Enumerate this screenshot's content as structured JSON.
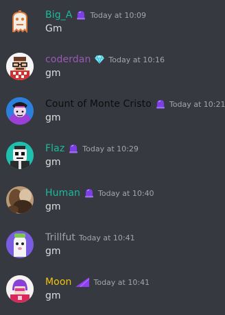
{
  "colors": {
    "background": "#36393f",
    "timestamp": "#a3a6aa",
    "message_text": "#dcddde"
  },
  "messages": [
    {
      "username": "Big_A",
      "color": "#1abc9c",
      "badge": "purple-orb-icon",
      "timestamp": "Today at 10:09",
      "content": "Gm",
      "avatar": "ghost-avatar-icon"
    },
    {
      "username": "coderdan",
      "color": "#9b59b6",
      "badge": "diamond-icon",
      "timestamp": "Today at 10:16",
      "content": "gm",
      "avatar": "glasses-avatar-icon"
    },
    {
      "username": "Count of Monte Cristo",
      "color": "#0d0d0d",
      "badge": "purple-orb-icon",
      "timestamp": "Today at 10:21",
      "content": "gm",
      "avatar": "hat-avatar-icon"
    },
    {
      "username": "Flaz",
      "color": "#1abc9c",
      "badge": "purple-orb-icon",
      "timestamp": "Today at 10:29",
      "content": "gm",
      "avatar": "robot-avatar-icon"
    },
    {
      "username": "Human",
      "color": "#1abc9c",
      "badge": "purple-orb-icon",
      "timestamp": "Today at 10:40",
      "content": "gm",
      "avatar": "photo-avatar-icon"
    },
    {
      "username": "Trillfut",
      "color": "#a0a4a9",
      "badge": "",
      "timestamp": "Today at 10:41",
      "content": "gm",
      "avatar": "alien-avatar-icon"
    },
    {
      "username": "Moon",
      "color": "#f1c40f",
      "badge": "purple-wedge-icon",
      "timestamp": "Today at 10:41",
      "content": "gm",
      "avatar": "helmet-avatar-icon"
    }
  ]
}
